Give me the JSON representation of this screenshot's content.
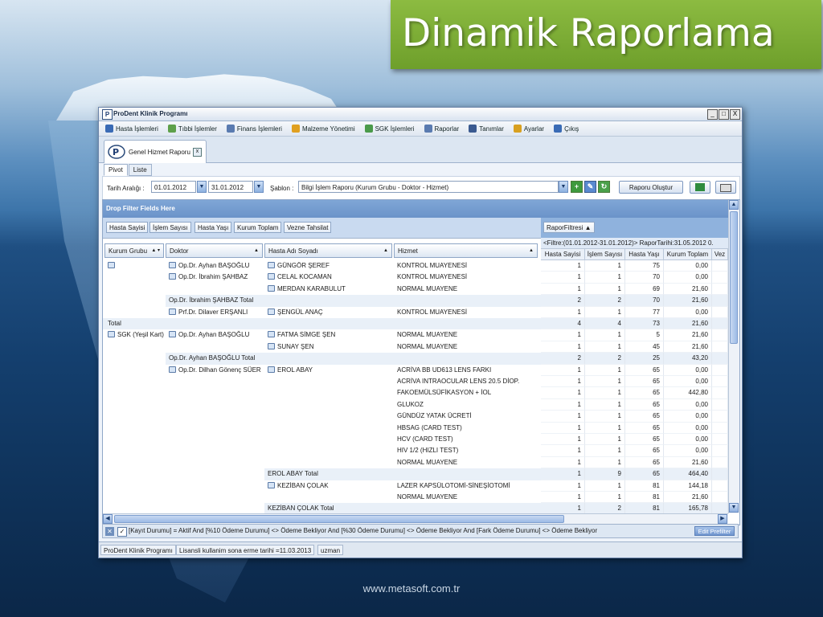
{
  "slide": {
    "title": "Dinamik Raporlama",
    "footer_url": "www.metasoft.com.tr"
  },
  "window": {
    "title": "ProDent Klinik Programı",
    "controls": [
      "_",
      "□",
      "X"
    ]
  },
  "menu": {
    "items": [
      {
        "label": "Hasta İşlemleri",
        "icon": "patients-icon",
        "color": "#3a6bb5"
      },
      {
        "label": "Tıbbi İşlemler",
        "icon": "shield-icon",
        "color": "#5ea04a"
      },
      {
        "label": "Finans İşlemleri",
        "icon": "finance-icon",
        "color": "#5a7bb0"
      },
      {
        "label": "Malzeme Yönetimi",
        "icon": "box-icon",
        "color": "#e0a020"
      },
      {
        "label": "SGK İşlemleri",
        "icon": "sgk-icon",
        "color": "#4a9a4a"
      },
      {
        "label": "Raporlar",
        "icon": "report-icon",
        "color": "#5a7bb0"
      },
      {
        "label": "Tanımlar",
        "icon": "definitions-icon",
        "color": "#3a5a90"
      },
      {
        "label": "Ayarlar",
        "icon": "settings-icon",
        "color": "#d8a020"
      },
      {
        "label": "Çıkış",
        "icon": "exit-icon",
        "color": "#3a6bb5"
      }
    ]
  },
  "doc_tab": {
    "label": "Genel Hizmet Raporu",
    "close": "x"
  },
  "subtabs": [
    "Pivot",
    "Liste"
  ],
  "filters": {
    "date_label": "Tarih Aralığı :",
    "date_from": "01.01.2012",
    "date_to": "31.01.2012",
    "template_label": "Şablon :",
    "template_value": "Bilgi İşlem Raporu (Kurum Grubu - Doktor - Hizmet)",
    "create_button": "Raporu Oluştur"
  },
  "pivot": {
    "drop_zone": "Drop Filter Fields Here",
    "data_fields": [
      "Hasta Sayisi",
      "İşlem Sayısı",
      "Hasta Yaşı",
      "Kurum Toplam",
      "Vezne Tahsilat"
    ],
    "column_field": "RaporFiltresi",
    "filter_text": "<Filtre:(01.01.2012-31.01.2012)> RaporTarihi:31.05.2012 0.",
    "row_fields": [
      "Kurum Grubu",
      "Doktor",
      "Hasta Adı Soyadı",
      "Hizmet"
    ],
    "data_headers": [
      "Hasta Sayisi",
      "İşlem Sayısı",
      "Hasta Yaşı",
      "Kurum Toplam",
      "Vez"
    ],
    "rows": [
      {
        "g": "",
        "d": "Op.Dr. Ayhan BAŞOĞLU",
        "p": "GÜNGÖR ŞEREF",
        "s": "KONTROL MUAYENESİ",
        "v": [
          "1",
          "1",
          "75",
          "0,00"
        ],
        "t": 0,
        "gi": 1,
        "di": 1,
        "pi": 1
      },
      {
        "g": "",
        "d": "Op.Dr. İbrahim ŞAHBAZ",
        "p": "CELAL KOCAMAN",
        "s": "KONTROL MUAYENESİ",
        "v": [
          "1",
          "1",
          "70",
          "0,00"
        ],
        "t": 0,
        "di": 1,
        "pi": 1
      },
      {
        "g": "",
        "d": "",
        "p": "MERDAN KARABULUT",
        "s": "NORMAL MUAYENE",
        "v": [
          "1",
          "1",
          "69",
          "21,60"
        ],
        "t": 0,
        "pi": 1
      },
      {
        "g": "",
        "d": "Op.Dr. İbrahim ŞAHBAZ Total",
        "p": "",
        "s": "",
        "v": [
          "2",
          "2",
          "70",
          "21,60"
        ],
        "t": 2
      },
      {
        "g": "",
        "d": "Prf.Dr. Dilaver ERŞANLI",
        "p": "ŞENGÜL ANAÇ",
        "s": "KONTROL MUAYENESİ",
        "v": [
          "1",
          "1",
          "77",
          "0,00"
        ],
        "t": 0,
        "di": 1,
        "pi": 1
      },
      {
        "g": "Total",
        "d": "",
        "p": "",
        "s": "",
        "v": [
          "4",
          "4",
          "73",
          "21,60"
        ],
        "t": 1
      },
      {
        "g": "SGK (Yeşil Kart)",
        "d": "Op.Dr. Ayhan BAŞOĞLU",
        "p": "FATMA SİMGE ŞEN",
        "s": "NORMAL MUAYENE",
        "v": [
          "1",
          "1",
          "5",
          "21,60"
        ],
        "t": 0,
        "gi": 1,
        "di": 1,
        "pi": 1
      },
      {
        "g": "",
        "d": "",
        "p": "SUNAY ŞEN",
        "s": "NORMAL MUAYENE",
        "v": [
          "1",
          "1",
          "45",
          "21,60"
        ],
        "t": 0,
        "pi": 1
      },
      {
        "g": "",
        "d": "Op.Dr. Ayhan BAŞOĞLU Total",
        "p": "",
        "s": "",
        "v": [
          "2",
          "2",
          "25",
          "43,20"
        ],
        "t": 2
      },
      {
        "g": "",
        "d": "Op.Dr. Dilhan Gönenç SÜER",
        "p": "EROL ABAY",
        "s": "ACRİVA BB UD613 LENS FARKI",
        "v": [
          "1",
          "1",
          "65",
          "0,00"
        ],
        "t": 0,
        "di": 1,
        "pi": 1
      },
      {
        "g": "",
        "d": "",
        "p": "",
        "s": "ACRİVA INTRAOCULAR LENS 20.5 DİOP.",
        "v": [
          "1",
          "1",
          "65",
          "0,00"
        ],
        "t": 0
      },
      {
        "g": "",
        "d": "",
        "p": "",
        "s": "FAKOEMÜLSÜFİKASYON + İOL",
        "v": [
          "1",
          "1",
          "65",
          "442,80"
        ],
        "t": 0
      },
      {
        "g": "",
        "d": "",
        "p": "",
        "s": "GLUKOZ",
        "v": [
          "1",
          "1",
          "65",
          "0,00"
        ],
        "t": 0
      },
      {
        "g": "",
        "d": "",
        "p": "",
        "s": "GÜNDÜZ YATAK ÜCRETİ",
        "v": [
          "1",
          "1",
          "65",
          "0,00"
        ],
        "t": 0
      },
      {
        "g": "",
        "d": "",
        "p": "",
        "s": "HBSAG (CARD TEST)",
        "v": [
          "1",
          "1",
          "65",
          "0,00"
        ],
        "t": 0
      },
      {
        "g": "",
        "d": "",
        "p": "",
        "s": "HCV (CARD TEST)",
        "v": [
          "1",
          "1",
          "65",
          "0,00"
        ],
        "t": 0
      },
      {
        "g": "",
        "d": "",
        "p": "",
        "s": "HIV 1/2 (HIZLI TEST)",
        "v": [
          "1",
          "1",
          "65",
          "0,00"
        ],
        "t": 0
      },
      {
        "g": "",
        "d": "",
        "p": "",
        "s": "NORMAL MUAYENE",
        "v": [
          "1",
          "1",
          "65",
          "21,60"
        ],
        "t": 0
      },
      {
        "g": "",
        "d": "",
        "p": "EROL ABAY Total",
        "s": "",
        "v": [
          "1",
          "9",
          "65",
          "464,40"
        ],
        "t": 3
      },
      {
        "g": "",
        "d": "",
        "p": "KEZİBAN ÇOLAK",
        "s": "LAZER KAPSÜLOTOMİ-SİNEŞİOTOMİ",
        "v": [
          "1",
          "1",
          "81",
          "144,18"
        ],
        "t": 0,
        "pi": 1
      },
      {
        "g": "",
        "d": "",
        "p": "",
        "s": "NORMAL MUAYENE",
        "v": [
          "1",
          "1",
          "81",
          "21,60"
        ],
        "t": 0
      },
      {
        "g": "",
        "d": "",
        "p": "KEZİBAN ÇOLAK Total",
        "s": "",
        "v": [
          "1",
          "2",
          "81",
          "165,78"
        ],
        "t": 3
      }
    ]
  },
  "filter_expression": "[Kayıt Durumu] = Aktif And [%10 Ödeme Durumu] <> Ödeme Bekliyor And [%30 Ödeme Durumu] <> Ödeme Bekliyor And [Fark Ödeme Durumu] <> Ödeme Bekliyor",
  "edit_prefilter": "Edit Prefilter",
  "status": [
    "ProDent Klinik Programı",
    "Lisansli kullanim sona erme tarihi =11.03.2013",
    "uzman"
  ]
}
